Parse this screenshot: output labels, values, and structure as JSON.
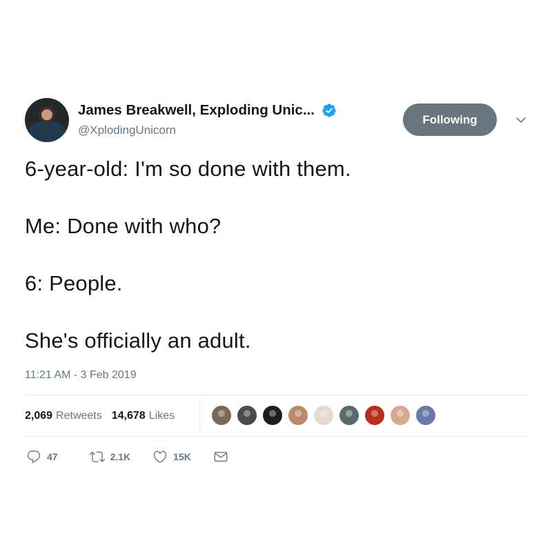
{
  "author": {
    "display_name": "James Breakwell, Exploding Unic...",
    "handle": "@XplodingUnicorn"
  },
  "follow_button_label": "Following",
  "tweet": {
    "lines": [
      "6-year-old: I'm so done with them.",
      "Me: Done with who?",
      "6: People.",
      "She's officially an adult."
    ],
    "timestamp": "11:21 AM - 3 Feb 2019"
  },
  "stats": {
    "retweets_count": "2,069",
    "retweets_label": "Retweets",
    "likes_count": "14,678",
    "likes_label": "Likes"
  },
  "likers": [
    {
      "icon": "liker-avatar",
      "color": "#7a6a5a"
    },
    {
      "icon": "liker-avatar",
      "color": "#4a4a4a"
    },
    {
      "icon": "liker-avatar",
      "color": "#1e1e1e"
    },
    {
      "icon": "liker-avatar",
      "color": "#b98a6a"
    },
    {
      "icon": "liker-avatar",
      "color": "#e8d8d0"
    },
    {
      "icon": "liker-avatar",
      "color": "#5a6a6a"
    },
    {
      "icon": "liker-avatar",
      "color": "#b8301a"
    },
    {
      "icon": "liker-avatar",
      "color": "#d8a890"
    },
    {
      "icon": "liker-avatar",
      "color": "#6a7aa8"
    }
  ],
  "actions": {
    "reply_count": "47",
    "retweet_count": "2.1K",
    "like_count": "15K"
  },
  "colors": {
    "text_primary": "#14171a",
    "text_secondary": "#657786",
    "button_bg": "#66757f",
    "verified_blue": "#1da1f2",
    "divider": "#e6ecf0"
  }
}
